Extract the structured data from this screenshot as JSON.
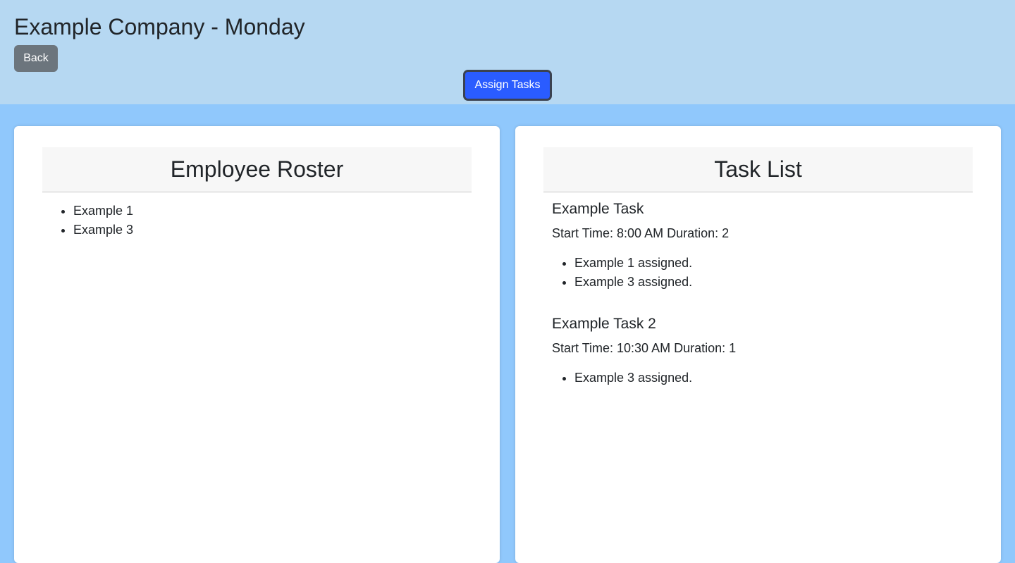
{
  "header": {
    "title": "Example Company - Monday",
    "back_label": "Back",
    "assign_label": "Assign Tasks"
  },
  "roster": {
    "title": "Employee Roster",
    "employees": [
      "Example 1",
      "Example 3"
    ]
  },
  "tasks": {
    "title": "Task List",
    "items": [
      {
        "name": "Example Task",
        "meta": "Start Time: 8:00 AM Duration: 2",
        "assigned": [
          "Example 1 assigned.",
          "Example 3 assigned."
        ]
      },
      {
        "name": "Example Task 2",
        "meta": "Start Time: 10:30 AM Duration: 1",
        "assigned": [
          "Example 3 assigned."
        ]
      }
    ]
  },
  "colors": {
    "header_bg": "#b6d8f2",
    "page_bg": "#90c8fc",
    "back_button": "#6c757d",
    "assign_button": "#2a5cff"
  }
}
